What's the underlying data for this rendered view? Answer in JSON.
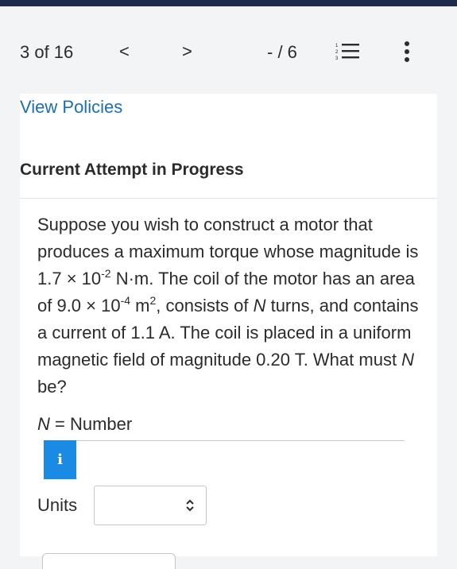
{
  "nav": {
    "question_counter": "3 of 16",
    "prev_glyph": "<",
    "next_glyph": ">",
    "score": "- / 6"
  },
  "header": {
    "policies_link": "View Policies",
    "attempt_heading": "Current Attempt in Progress"
  },
  "question": {
    "line1": "Suppose you wish to construct a motor that produces a maximum torque whose magnitude is 1.7 × 10",
    "exp1": "-2",
    "line2": " N·m. The coil of the motor has an area of 9.0 × 10",
    "exp2": "-4",
    "line3": " m",
    "exp3": "2",
    "line4": ", consists of ",
    "n_var": "N",
    "line5": " turns, and contains a current of 1.1 A. The coil is placed in a uniform magnetic field of magnitude 0.20 T. What must ",
    "n_var2": "N",
    "line6": " be?"
  },
  "answer": {
    "var": "N",
    "label_suffix": " = Number",
    "info_glyph": "i",
    "value": "",
    "placeholder": ""
  },
  "units": {
    "label": "Units",
    "selected": ""
  },
  "colors": {
    "accent": "#1a8ae5",
    "link": "#1a6fb0",
    "topbar": "#1d2a4a"
  },
  "icons": {
    "list": "numbered-list-icon",
    "more": "more-vertical-icon",
    "select": "updown-chevron-icon"
  }
}
